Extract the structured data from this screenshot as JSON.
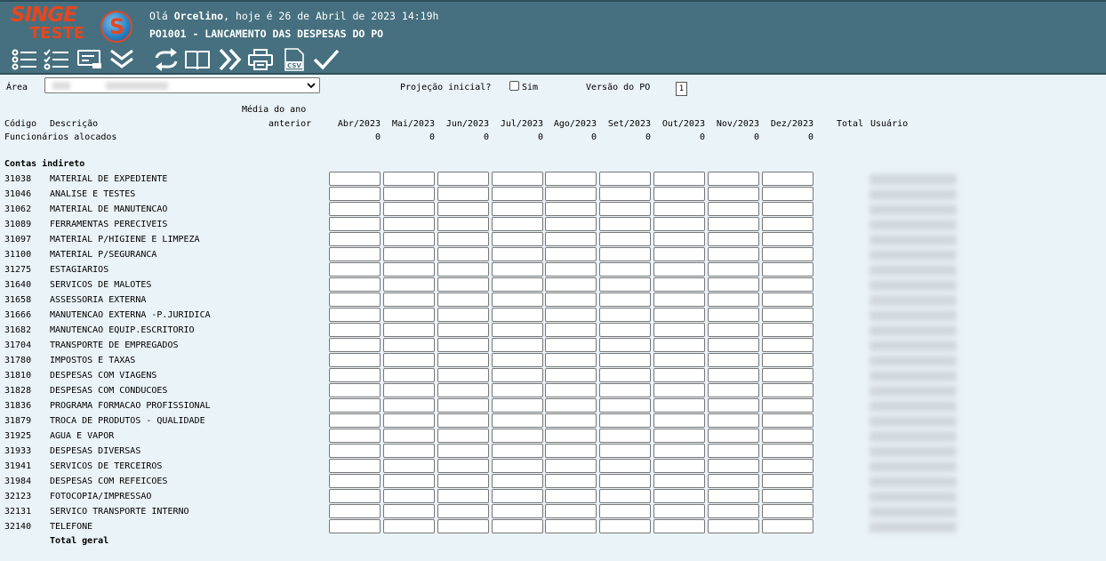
{
  "header": {
    "logo_main": "SINGE",
    "logo_sub": "TESTE",
    "logo_letter": "S",
    "greeting_prefix": "Olá",
    "user_name": "Orcelino",
    "greeting_suffix": ", hoje é 26 de Abril de 2023 14:19h",
    "page_title": "PO1001 - LANCAMENTO DAS DESPESAS DO PO"
  },
  "toolbar": {
    "icons": [
      "list-icon",
      "checklist-icon",
      "card-icon",
      "double-chevron-down-icon",
      "refresh-icon",
      "book-icon",
      "double-chevron-right-icon",
      "print-icon",
      "csv-icon",
      "check-icon"
    ],
    "csv_label": "CSV"
  },
  "filters": {
    "area_label": "Área",
    "projecao_label": "Projeção inicial?",
    "sim_label": "Sim",
    "versao_label": "Versão do PO",
    "versao_value": "1"
  },
  "table": {
    "media_line1": "Média do ano",
    "media_line2": "anterior",
    "codigo_header": "Código",
    "descricao_header": "Descrição",
    "months": [
      "Abr/2023",
      "Mai/2023",
      "Jun/2023",
      "Jul/2023",
      "Ago/2023",
      "Set/2023",
      "Out/2023",
      "Nov/2023",
      "Dez/2023"
    ],
    "total_header": "Total",
    "usuario_header": "Usuário",
    "funcionarios_label": "Funcionários alocados",
    "funcionarios_values": [
      "0",
      "0",
      "0",
      "0",
      "0",
      "0",
      "0",
      "0",
      "0"
    ],
    "section_label": "Contas indireto",
    "rows": [
      {
        "code": "31038",
        "desc": "MATERIAL DE EXPEDIENTE"
      },
      {
        "code": "31046",
        "desc": "ANALISE E TESTES"
      },
      {
        "code": "31062",
        "desc": "MATERIAL DE MANUTENCAO"
      },
      {
        "code": "31089",
        "desc": "FERRAMENTAS PERECIVEIS"
      },
      {
        "code": "31097",
        "desc": "MATERIAL P/HIGIENE E LIMPEZA"
      },
      {
        "code": "31100",
        "desc": "MATERIAL P/SEGURANCA"
      },
      {
        "code": "31275",
        "desc": "ESTAGIARIOS"
      },
      {
        "code": "31640",
        "desc": "SERVICOS DE MALOTES"
      },
      {
        "code": "31658",
        "desc": "ASSESSORIA EXTERNA"
      },
      {
        "code": "31666",
        "desc": "MANUTENCAO EXTERNA -P.JURIDICA"
      },
      {
        "code": "31682",
        "desc": "MANUTENCAO EQUIP.ESCRITORIO"
      },
      {
        "code": "31704",
        "desc": "TRANSPORTE DE EMPREGADOS"
      },
      {
        "code": "31780",
        "desc": "IMPOSTOS E TAXAS"
      },
      {
        "code": "31810",
        "desc": "DESPESAS COM VIAGENS"
      },
      {
        "code": "31828",
        "desc": "DESPESAS COM CONDUCOES"
      },
      {
        "code": "31836",
        "desc": "PROGRAMA FORMACAO PROFISSIONAL"
      },
      {
        "code": "31879",
        "desc": "TROCA DE PRODUTOS - QUALIDADE"
      },
      {
        "code": "31925",
        "desc": "AGUA E VAPOR"
      },
      {
        "code": "31933",
        "desc": "DESPESAS DIVERSAS"
      },
      {
        "code": "31941",
        "desc": "SERVICOS DE TERCEIROS"
      },
      {
        "code": "31984",
        "desc": "DESPESAS COM REFEICOES"
      },
      {
        "code": "32123",
        "desc": "FOTOCOPIA/IMPRESSAO"
      },
      {
        "code": "32131",
        "desc": "SERVICO TRANSPORTE INTERNO"
      },
      {
        "code": "32140",
        "desc": "TELEFONE"
      }
    ],
    "total_geral_label": "Total geral"
  }
}
